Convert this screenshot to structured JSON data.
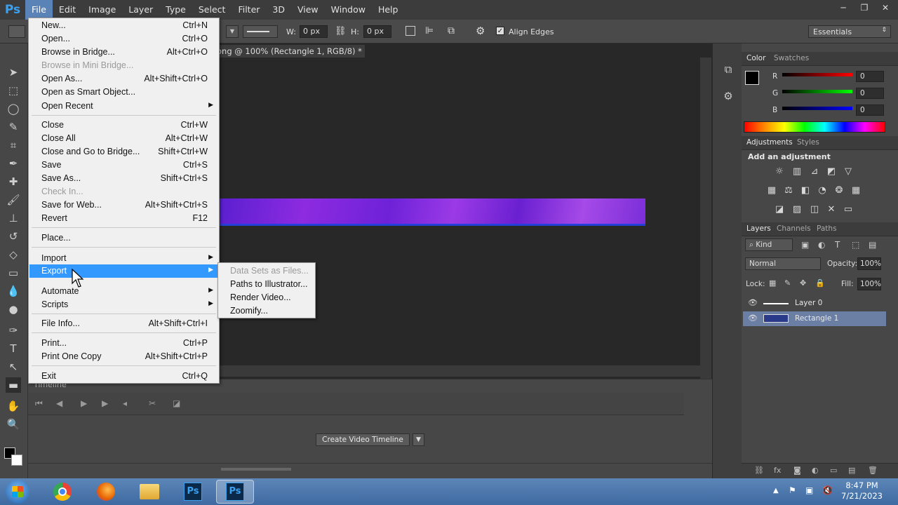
{
  "app": {
    "logo": "Ps",
    "menubar": [
      "File",
      "Edit",
      "Image",
      "Layer",
      "Type",
      "Select",
      "Filter",
      "3D",
      "View",
      "Window",
      "Help"
    ],
    "active_menu": "File"
  },
  "window_controls": {
    "minimize": "─",
    "restore": "❐",
    "close": "✕"
  },
  "options_bar": {
    "w_label": "W:",
    "w_value": "0 px",
    "h_label": "H:",
    "h_value": "0 px",
    "align_edges": "Align Edges",
    "workspace": "Essentials"
  },
  "document": {
    "tab_title": "ong @ 100% (Rectangle 1, RGB/8) *",
    "close": "×"
  },
  "timeline": {
    "tab": "Timeline",
    "create_button": "Create Video Timeline"
  },
  "file_menu": {
    "items": [
      {
        "label": "New...",
        "shortcut": "Ctrl+N"
      },
      {
        "label": "Open...",
        "shortcut": "Ctrl+O"
      },
      {
        "label": "Browse in Bridge...",
        "shortcut": "Alt+Ctrl+O"
      },
      {
        "label": "Browse in Mini Bridge...",
        "shortcut": "",
        "disabled": true
      },
      {
        "label": "Open As...",
        "shortcut": "Alt+Shift+Ctrl+O"
      },
      {
        "label": "Open as Smart Object...",
        "shortcut": ""
      },
      {
        "label": "Open Recent",
        "shortcut": "",
        "submenu": true
      },
      {
        "label": "Close",
        "shortcut": "Ctrl+W"
      },
      {
        "label": "Close All",
        "shortcut": "Alt+Ctrl+W"
      },
      {
        "label": "Close and Go to Bridge...",
        "shortcut": "Shift+Ctrl+W"
      },
      {
        "label": "Save",
        "shortcut": "Ctrl+S"
      },
      {
        "label": "Save As...",
        "shortcut": "Shift+Ctrl+S"
      },
      {
        "label": "Check In...",
        "shortcut": "",
        "disabled": true
      },
      {
        "label": "Save for Web...",
        "shortcut": "Alt+Shift+Ctrl+S"
      },
      {
        "label": "Revert",
        "shortcut": "F12"
      },
      {
        "label": "Place...",
        "shortcut": ""
      },
      {
        "label": "Import",
        "shortcut": "",
        "submenu": true
      },
      {
        "label": "Export",
        "shortcut": "",
        "submenu": true,
        "highlighted": true
      },
      {
        "label": "Automate",
        "shortcut": "",
        "submenu": true
      },
      {
        "label": "Scripts",
        "shortcut": "",
        "submenu": true
      },
      {
        "label": "File Info...",
        "shortcut": "Alt+Shift+Ctrl+I"
      },
      {
        "label": "Print...",
        "shortcut": "Ctrl+P"
      },
      {
        "label": "Print One Copy",
        "shortcut": "Alt+Shift+Ctrl+P"
      },
      {
        "label": "Exit",
        "shortcut": "Ctrl+Q"
      }
    ]
  },
  "export_submenu": {
    "items": [
      {
        "label": "Data Sets as Files...",
        "disabled": true
      },
      {
        "label": "Paths to Illustrator..."
      },
      {
        "label": "Render Video..."
      },
      {
        "label": "Zoomify..."
      }
    ]
  },
  "color_panel": {
    "tabs": [
      "Color",
      "Swatches"
    ],
    "r_label": "R",
    "r_value": "0",
    "g_label": "G",
    "g_value": "0",
    "b_label": "B",
    "b_value": "0"
  },
  "adjustments_panel": {
    "tabs": [
      "Adjustments",
      "Styles"
    ],
    "heading": "Add an adjustment"
  },
  "layers_panel": {
    "tabs": [
      "Layers",
      "Channels",
      "Paths"
    ],
    "filter_kind": "Kind",
    "blend_mode": "Normal",
    "opacity_label": "Opacity:",
    "opacity_value": "100%",
    "lock_label": "Lock:",
    "fill_label": "Fill:",
    "fill_value": "100%",
    "layers": [
      {
        "name": "Layer 0",
        "selected": false
      },
      {
        "name": "Rectangle 1",
        "selected": true
      }
    ]
  },
  "taskbar": {
    "time": "8:47 PM",
    "date": "7/21/2023",
    "ps_label": "Ps"
  }
}
